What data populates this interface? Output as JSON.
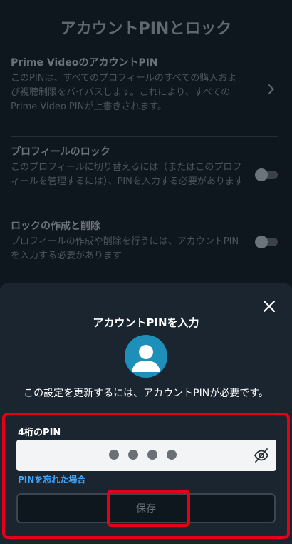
{
  "page": {
    "title": "アカウントPINとロック"
  },
  "settings": [
    {
      "title": "Prime VideoのアカウントPIN",
      "description": "このPINは、すべてのプロフィールのすべての購入および視聴制限をバイパスします。これにより、すべてのPrime Video PINが上書きされます。"
    },
    {
      "title": "プロフィールのロック",
      "description": "このプロフィールに切り替えるには（またはこのプロフィールを管理するには）、PINを入力する必要があります",
      "toggle_on": false
    },
    {
      "title": "ロックの作成と削除",
      "description": "プロフィールの作成や削除を行うには、アカウントPINを入力する必要があります",
      "toggle_on": false
    }
  ],
  "sheet": {
    "title": "アカウントPINを入力",
    "message": "この設定を更新するには、アカウントPINが必要です。",
    "pin_label": "4桁のPIN",
    "pin_digits_entered": 4,
    "forgot_link": "PINを忘れた場合",
    "save_label": "保存",
    "icons": {
      "close": "close-icon",
      "avatar": "avatar-icon",
      "visibility": "eye-off-icon"
    }
  },
  "colors": {
    "background": "#0f171e",
    "sheet": "#1b2530",
    "link": "#3ea6ff",
    "highlight": "#e3001b"
  }
}
